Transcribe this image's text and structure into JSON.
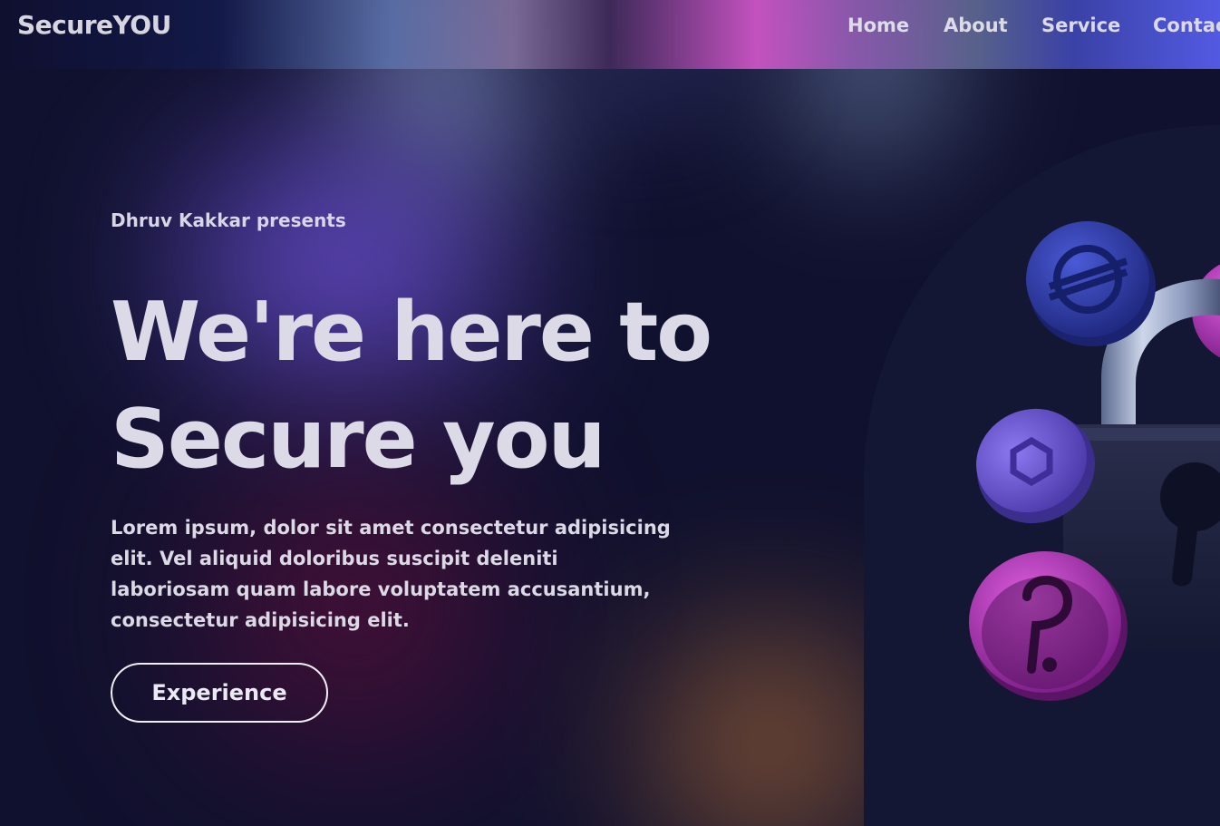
{
  "header": {
    "brand": "SecureYOU",
    "nav": [
      {
        "label": "Home"
      },
      {
        "label": "About"
      },
      {
        "label": "Service"
      },
      {
        "label": "Contac"
      }
    ]
  },
  "hero": {
    "presenter": "Dhruv Kakkar presents",
    "headline_line1": "We're here to",
    "headline_line2": "Secure you",
    "description": "Lorem ipsum, dolor sit amet consectetur adipisicing elit. Vel aliquid doloribus suscipit deleniti laboriosam quam labore voluptatem accusantium, consectetur adipisicing elit.",
    "cta_label": "Experience"
  },
  "illustration": {
    "icons": [
      "padlock-icon",
      "stellar-coin-icon",
      "polygon-coin-icon",
      "polkadot-coin-icon"
    ]
  },
  "colors": {
    "background": "#10112e",
    "coin_blue": "#2e3ca8",
    "coin_violet": "#6a54d8",
    "coin_magenta": "#c23ec6",
    "text": "#dcdae6"
  }
}
